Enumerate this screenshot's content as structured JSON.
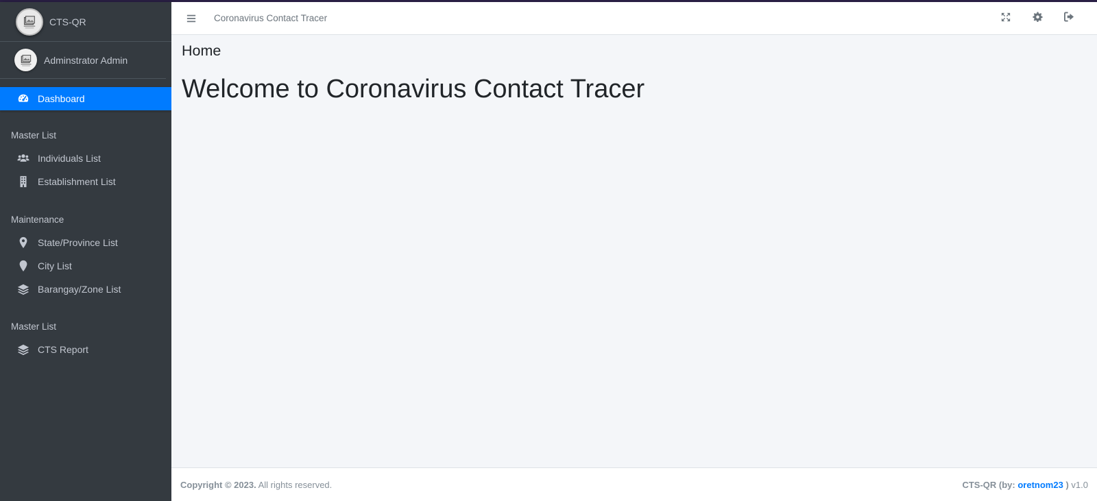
{
  "brand": {
    "name": "CTS-QR",
    "logo_icon": "image-not-available-icon"
  },
  "user": {
    "name": "Adminstrator Admin",
    "avatar_icon": "image-not-available-icon"
  },
  "navbar": {
    "title": "Coronavirus Contact Tracer",
    "icons": [
      "bars-icon",
      "expand-icon",
      "gear-icon",
      "sign-out-icon"
    ]
  },
  "sidebar": {
    "dashboard": {
      "label": "Dashboard",
      "icon": "tachometer-icon"
    },
    "section1": "Master List",
    "individuals": {
      "label": "Individuals List",
      "icon": "users-icon"
    },
    "establishments": {
      "label": "Establishment List",
      "icon": "building-icon"
    },
    "section2": "Maintenance",
    "states": {
      "label": "State/Province List",
      "icon": "map-marker-icon"
    },
    "cities": {
      "label": "City List",
      "icon": "map-pin-icon"
    },
    "barangays": {
      "label": "Barangay/Zone List",
      "icon": "layers-icon"
    },
    "section3": "Master List",
    "report": {
      "label": "CTS Report",
      "icon": "layers-icon"
    }
  },
  "main": {
    "page_title": "Home",
    "welcome": "Welcome to Coronavirus Contact Tracer"
  },
  "footer": {
    "copyright": "Copyright © 2023.",
    "rights": "All rights reserved.",
    "credit_prefix": "CTS-QR (by:",
    "author": "oretnom23",
    "credit_suffix": ")",
    "version": "v1.0"
  },
  "colors": {
    "sidebar_bg": "#343a40",
    "active": "#007bff",
    "content_bg": "#f4f6f9"
  }
}
